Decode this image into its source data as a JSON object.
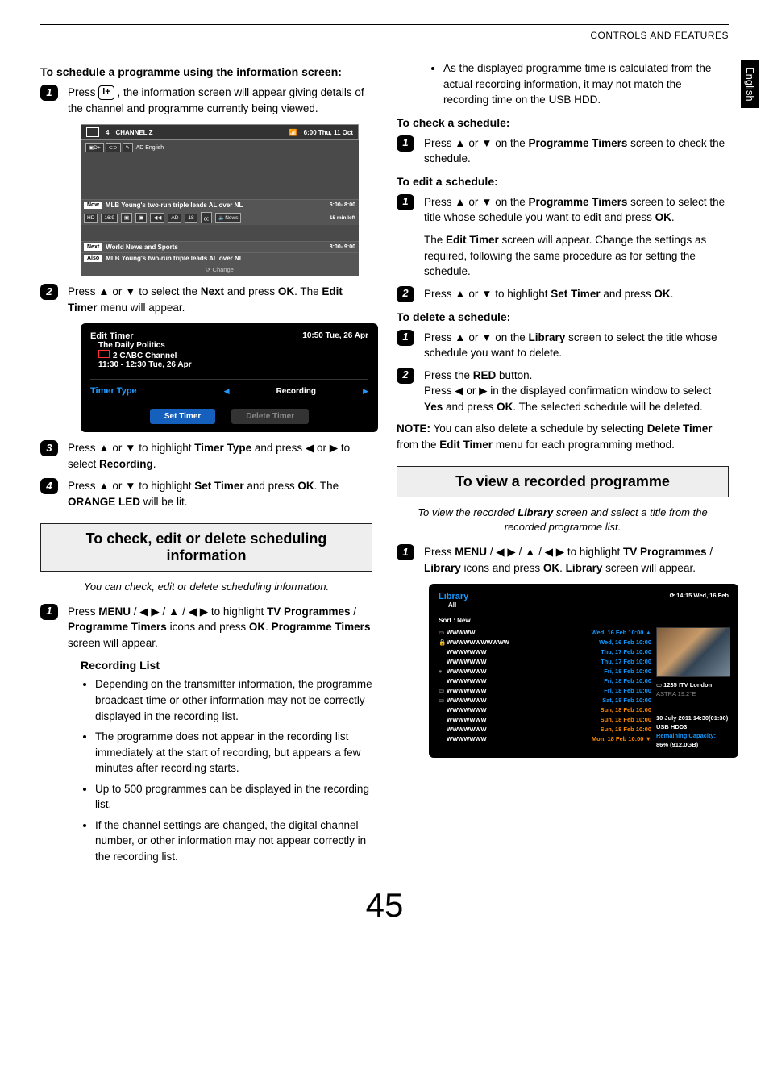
{
  "header": {
    "breadcrumb": "CONTROLS AND FEATURES",
    "sideTab": "English"
  },
  "pageNumber": "45",
  "left": {
    "h1": "To schedule a programme using the information screen:",
    "step1": {
      "pre": "Press ",
      "btn": "i+",
      "post": " , the information screen will appear giving details of the channel and programme currently being viewed."
    },
    "infoScreen": {
      "channelNum": "4",
      "channelName": "CHANNEL Z",
      "clock": "6:00 Thu, 11 Oct",
      "adEnglish": "AD English",
      "now": {
        "label": "Now",
        "text": "MLB Young's two-run triple leads AL over NL",
        "time": "6:00- 8:00"
      },
      "hdRow": {
        "left": "15 min left",
        "badges": [
          "HD",
          "16:9",
          "▣",
          "▣",
          "◀◀",
          "AD",
          "18",
          "㏄",
          "🔈News"
        ]
      },
      "next": {
        "label": "Next",
        "text": "World News and Sports",
        "time": "8:00- 9:00"
      },
      "also": {
        "label": "Also",
        "text": "MLB Young's two-run triple leads AL over NL"
      },
      "change": "Change"
    },
    "step2": "Press ▲ or ▼ to select the <b>Next</b> and press <b>OK</b>. The <b>Edit Timer</b> menu will appear.",
    "editTimer": {
      "title": "Edit Timer",
      "topTime": "10:50 Tue, 26 Apr",
      "line2": "The Daily Politics",
      "line3": "2 CABC Channel",
      "line4": "11:30 - 12:30 Tue, 26 Apr",
      "rowLabel": "Timer Type",
      "rowValue": "Recording",
      "btnSet": "Set Timer",
      "btnDel": "Delete Timer"
    },
    "step3": "Press ▲ or ▼ to highlight <b>Timer Type</b> and press ◀ or ▶ to select <b>Recording</b>.",
    "step4": "Press ▲ or ▼ to highlight <b>Set Timer</b> and press <b>OK</b>. The <b>ORANGE LED</b> will be lit.",
    "section2": "To check, edit or delete scheduling information",
    "section2Intro": "You can check, edit or delete scheduling information.",
    "sec2Step1": "Press <b>MENU</b> / ◀ ▶ / ▲ / ◀ ▶ to highlight <b>TV Programmes</b> / <b>Programme Timers</b> icons and press <b>OK</b>. <b>Programme Timers</b> screen will appear.",
    "recHeading": "Recording List",
    "recBullets": [
      "Depending on the transmitter information, the programme broadcast time or other information may not be correctly displayed in the recording list.",
      "The programme does not appear in the recording list immediately at the start of recording, but appears a few minutes after recording starts.",
      "Up to 500 programmes can be displayed in the recording list.",
      "If the channel settings are changed, the digital channel number, or other information may not appear correctly in the recording list."
    ]
  },
  "right": {
    "topBullet": "As the displayed programme time is calculated from the actual recording information, it may not match the recording time on the USB HDD.",
    "checkH": "To check a schedule:",
    "checkStep1": "Press ▲ or ▼ on the <b>Programme Timers</b> screen to check the schedule.",
    "editH": "To edit a schedule:",
    "editStep1a": "Press ▲ or ▼ on the <b>Programme Timers</b> screen to select the title whose schedule you want to edit and press <b>OK</b>.",
    "editStep1b": "The <b>Edit Timer</b> screen will appear. Change the settings as required, following the same procedure as for setting the schedule.",
    "editStep2": "Press ▲ or ▼ to highlight <b>Set Timer</b> and press <b>OK</b>.",
    "delH": "To delete a schedule:",
    "delStep1": "Press ▲ or ▼ on the <b>Library</b> screen to select the title whose schedule you want to delete.",
    "delStep2a": "Press the <b>RED</b> button.",
    "delStep2b": "Press ◀ or ▶ in the displayed confirmation window to select <b>Yes</b> and press <b>OK</b>. The selected schedule will be deleted.",
    "note": "<b>NOTE:</b> You can also delete a schedule by selecting <b>Delete Timer</b> from the <b>Edit Timer</b> menu for each programming method.",
    "section3": "To view a recorded programme",
    "section3Intro": "To view the recorded <b>Library</b> screen and select a title from the recorded programme list.",
    "sec3Step1": "Press <b>MENU</b> / ◀ ▶ / ▲ / ◀ ▶ to highlight <b>TV Programmes</b> / <b>Library</b> icons and press <b>OK</b>. <b>Library</b> screen will appear.",
    "library": {
      "title": "Library",
      "topTime": "14:15 Wed, 16 Feb",
      "all": "All",
      "sort": "Sort : New",
      "rows": [
        {
          "ico": "rec",
          "name": "WWWWW",
          "dt": "Wed, 16 Feb 10:00",
          "c": "blue",
          "arr": "▲"
        },
        {
          "ico": "lock",
          "name": "WWWWWWWWWWW",
          "dt": "Wed, 16 Feb 10:00",
          "c": "blue"
        },
        {
          "ico": "",
          "name": "WWWWWWW",
          "dt": "Thu, 17 Feb 10:00",
          "c": "blue"
        },
        {
          "ico": "",
          "name": "WWWWWWW",
          "dt": "Thu, 17 Feb 10:00",
          "c": "blue"
        },
        {
          "ico": "dot",
          "name": "WWWWWWW",
          "dt": "Fri, 18 Feb 10:00",
          "c": "blue"
        },
        {
          "ico": "",
          "name": "WWWWWWW",
          "dt": "Fri, 18 Feb 10:00",
          "c": "blue"
        },
        {
          "ico": "rec",
          "name": "WWWWWWW",
          "dt": "Fri, 18 Feb 10:00",
          "c": "blue"
        },
        {
          "ico": "rec",
          "name": "WWWWWWW",
          "dt": "Sat, 18 Feb 10:00",
          "c": "blue"
        },
        {
          "ico": "",
          "name": "WWWWWWW",
          "dt": "Sun, 18 Feb 10:00",
          "c": "orange"
        },
        {
          "ico": "",
          "name": "WWWWWWW",
          "dt": "Sun, 18 Feb 10:00",
          "c": "orange"
        },
        {
          "ico": "",
          "name": "WWWWWWW",
          "dt": "Sun, 18 Feb 10:00",
          "c": "orange"
        },
        {
          "ico": "",
          "name": "WWWWWWW",
          "dt": "Mon, 18 Feb 10:00",
          "c": "orange",
          "arr": "▼"
        }
      ],
      "meta": {
        "channel": "1235 ITV London",
        "sat": "ASTRA 19.2°E",
        "date": "10 July 2011  14:30(01:30)",
        "hdd": "USB HDD3",
        "capLabel": "Remaining Capacity:",
        "cap": "86% (912.0GB)"
      }
    }
  }
}
